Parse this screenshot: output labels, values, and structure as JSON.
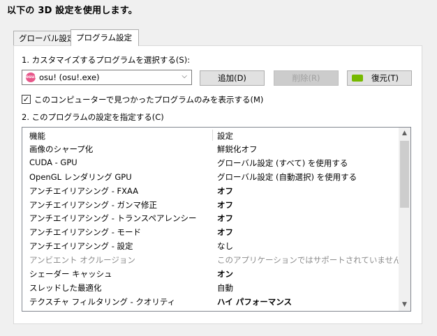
{
  "header": {
    "title": "以下の 3D 設定を使用します。"
  },
  "tabs": [
    {
      "label": "グローバル設定"
    },
    {
      "label": "プログラム設定"
    }
  ],
  "section1": {
    "label": "1. カスタマイズするプログラムを選択する(S):"
  },
  "program_select": {
    "value": "osu! (osu!.exe)",
    "icon": "osu-app-icon",
    "icon_text": "osu!"
  },
  "buttons": {
    "add": "追加(D)",
    "delete": "削除(R)",
    "restore": "復元(T)"
  },
  "checkbox": {
    "label": "このコンピューターで見つかったプログラムのみを表示する(M)",
    "checked": true
  },
  "section2": {
    "label": "2. このプログラムの設定を指定する(C)"
  },
  "table": {
    "headers": {
      "feature": "機能",
      "setting": "設定"
    },
    "rows": [
      {
        "feature": "画像のシャープ化",
        "setting": "鮮鋭化オフ"
      },
      {
        "feature": "CUDA - GPU",
        "setting": "グローバル設定 (すべて) を使用する"
      },
      {
        "feature": "OpenGL レンダリング GPU",
        "setting": "グローバル設定 (自動選択) を使用する"
      },
      {
        "feature": "アンチエイリアシング - FXAA",
        "setting": "オフ"
      },
      {
        "feature": "アンチエイリアシング - ガンマ修正",
        "setting": "オフ"
      },
      {
        "feature": "アンチエイリアシング - トランスペアレンシー",
        "setting": "オフ"
      },
      {
        "feature": "アンチエイリアシング - モード",
        "setting": "オフ"
      },
      {
        "feature": "アンチエイリアシング - 設定",
        "setting": "なし"
      },
      {
        "feature": "アンビエント オクルージョン",
        "setting": "このアプリケーションではサポートされていません"
      },
      {
        "feature": "シェーダー キャッシュ",
        "setting": "オン"
      },
      {
        "feature": "スレッドした最適化",
        "setting": "自動"
      },
      {
        "feature": "テクスチャ フィルタリング - クオリティ",
        "setting": "ハイ パフォーマンス"
      }
    ]
  },
  "colors": {
    "accent_nvidia": "#76b900",
    "osu_icon": "#e8578a",
    "disabled_text": "#8c8c8c"
  }
}
